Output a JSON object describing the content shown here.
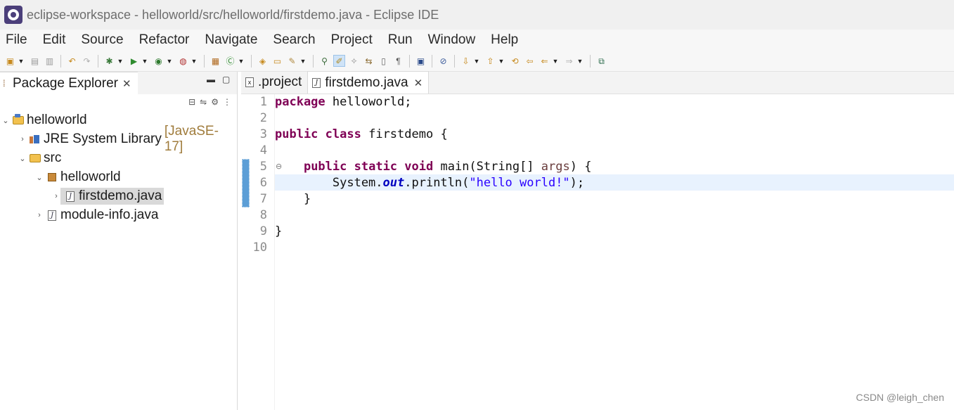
{
  "window": {
    "title": "eclipse-workspace - helloworld/src/helloworld/firstdemo.java - Eclipse IDE"
  },
  "menu": [
    "File",
    "Edit",
    "Source",
    "Refactor",
    "Navigate",
    "Search",
    "Project",
    "Run",
    "Window",
    "Help"
  ],
  "explorer": {
    "tab_label": "Package Explorer",
    "tree": {
      "project": "helloworld",
      "jre_label": "JRE System Library",
      "jre_decoration": "[JavaSE-17]",
      "src": "src",
      "package": "helloworld",
      "file_selected": "firstdemo.java",
      "module_file": "module-info.java"
    }
  },
  "editor": {
    "tabs": [
      {
        "label": ".project",
        "icon": "x"
      },
      {
        "label": "firstdemo.java",
        "icon": "J"
      }
    ],
    "line_numbers": [
      "1",
      "2",
      "3",
      "4",
      "5",
      "6",
      "7",
      "8",
      "9",
      "10"
    ],
    "code": {
      "l1_kw": "package",
      "l1_rest": " helloworld;",
      "l3_kw1": "public",
      "l3_kw2": "class",
      "l3_rest": " firstdemo {",
      "l5_indent": "    ",
      "l5_kw1": "public",
      "l5_kw2": "static",
      "l5_kw3": "void",
      "l5_mid": " main(String[] ",
      "l5_param": "args",
      "l5_end": ") {",
      "l6_pre": "        System.",
      "l6_field": "out",
      "l6_mid": ".println(",
      "l6_str": "\"hello world!\"",
      "l6_end": ");",
      "l7": "    }",
      "l9": "}"
    }
  },
  "watermark": "CSDN @leigh_chen",
  "colors": {
    "keyword": "#7f0055",
    "string": "#2a00ff",
    "field": "#0000c0",
    "current_line": "#e8f2fe"
  }
}
